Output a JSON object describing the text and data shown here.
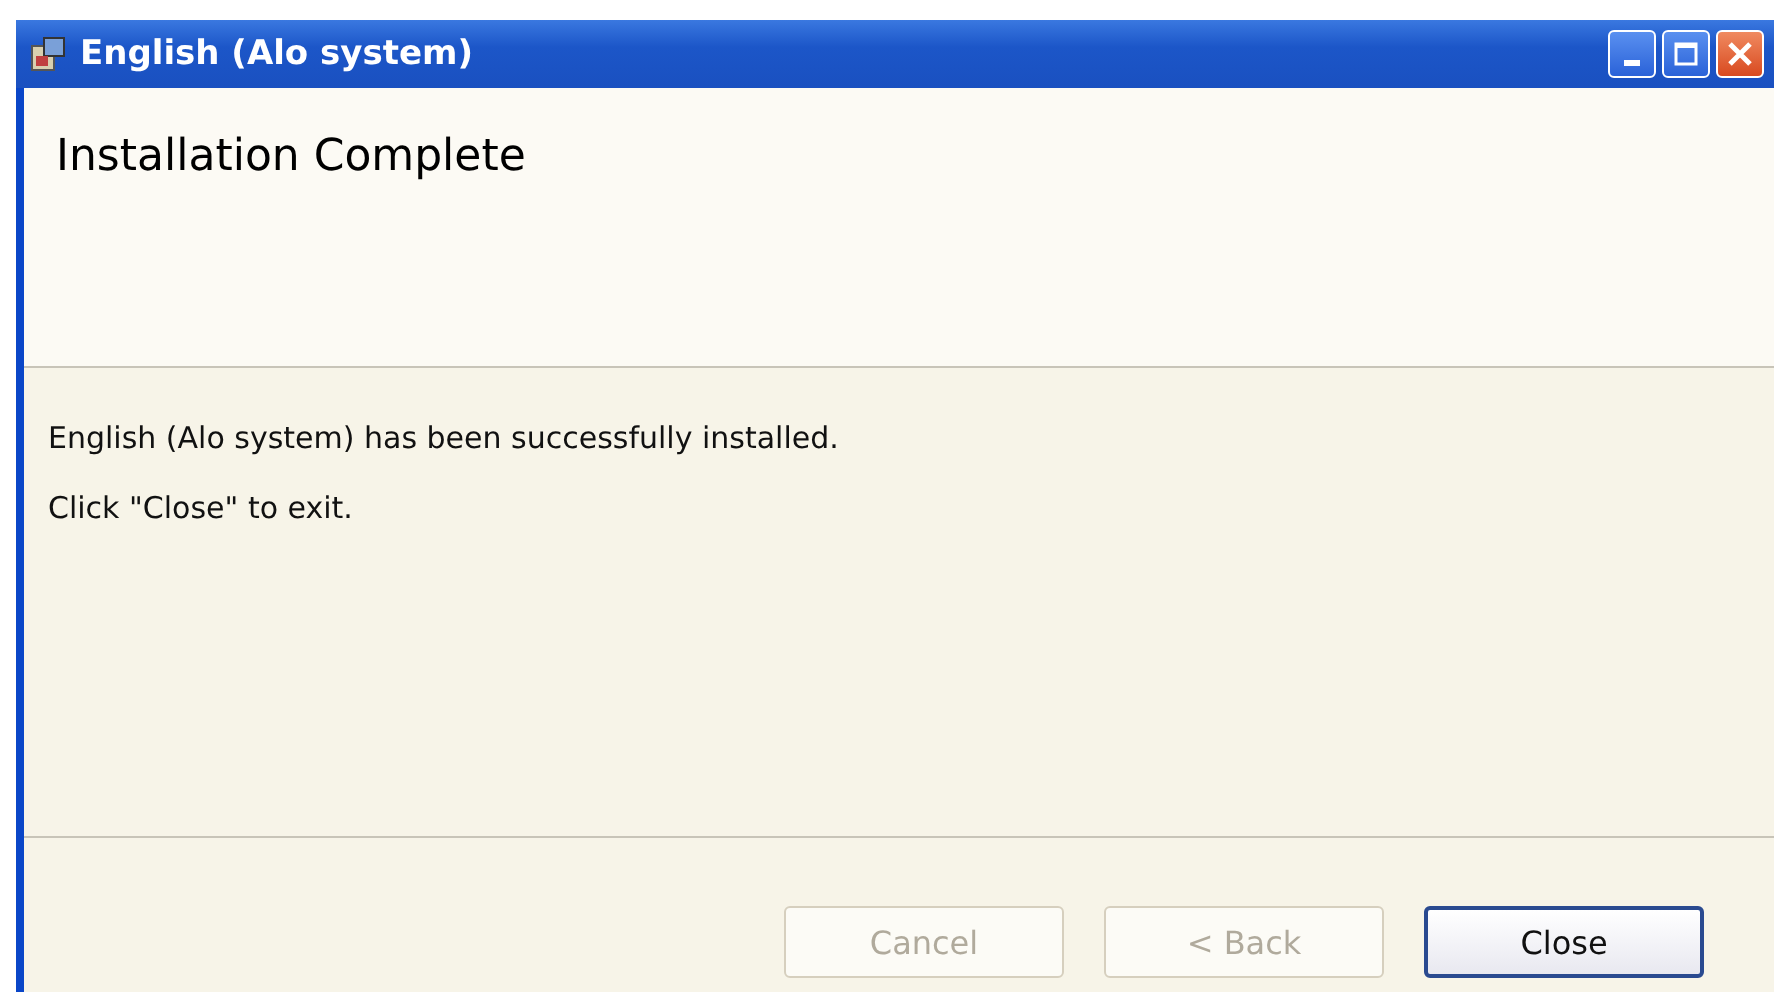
{
  "window": {
    "title": "English (Alo system)"
  },
  "header": {
    "title": "Installation Complete"
  },
  "body": {
    "lines": [
      "English (Alo system) has been successfully installed.",
      "Click \"Close\" to exit."
    ]
  },
  "buttons": [
    {
      "label": "Cancel",
      "disabled": true,
      "default": false
    },
    {
      "label": "< Back",
      "disabled": true,
      "default": false
    },
    {
      "label": "Close",
      "disabled": false,
      "default": true
    }
  ]
}
